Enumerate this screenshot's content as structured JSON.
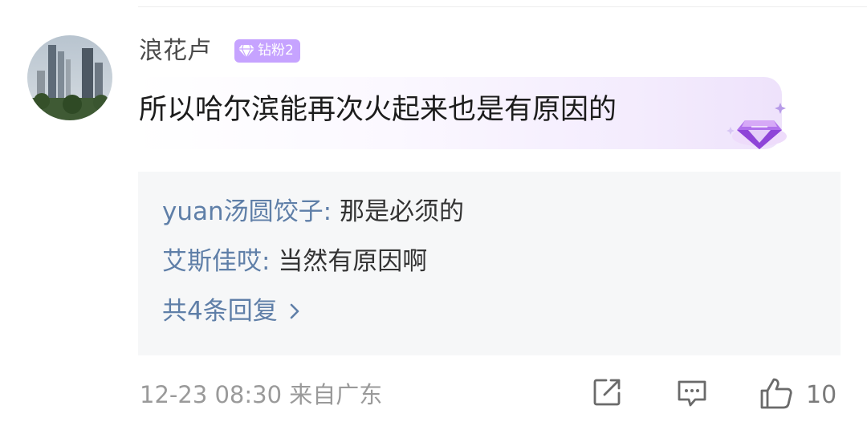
{
  "comment": {
    "username": "浪花卢",
    "badge": {
      "label": "钻粉2",
      "color": "#c6a3ff",
      "icon": "diamond-icon"
    },
    "text": "所以哈尔滨能再次火起来也是有原因的",
    "replies": [
      {
        "name": "yuan汤圆饺子",
        "separator": ": ",
        "text": "那是必须的"
      },
      {
        "name": "艾斯佳哎",
        "separator": ": ",
        "text": "当然有原因啊"
      }
    ],
    "more_replies_label": "共4条回复",
    "meta": "12-23 08:30 来自广东",
    "like_count": "10"
  },
  "icons": {
    "share": "share-icon",
    "reply": "comment-icon",
    "like": "thumbs-up-icon",
    "more": "chevron-right-icon",
    "decoration": "diamond-decoration-icon"
  },
  "colors": {
    "link_blue": "#5f7fa8",
    "badge_purple": "#c6a3ff",
    "reply_bg": "#f6f7f8"
  }
}
